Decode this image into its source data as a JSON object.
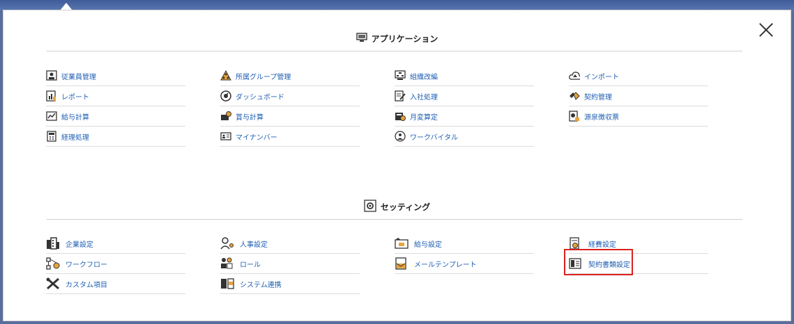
{
  "applications": {
    "title": "アプリケーション",
    "columns": [
      [
        "従業員管理",
        "レポート",
        "給与計算",
        "経理処理"
      ],
      [
        "所属グループ管理",
        "ダッシュボード",
        "賞与計算",
        "マイナンバー"
      ],
      [
        "組織改編",
        "入社処理",
        "月変算定",
        "ワークバイタル"
      ],
      [
        "インポート",
        "契約管理",
        "源泉徴収票"
      ]
    ]
  },
  "settings": {
    "title": "セッティング",
    "columns": [
      [
        "企業設定",
        "ワークフロー",
        "カスタム項目"
      ],
      [
        "人事設定",
        "ロール",
        "システム連携"
      ],
      [
        "給与設定",
        "メールテンプレート"
      ],
      [
        "経費設定",
        "契約書類設定"
      ]
    ]
  },
  "colors": {
    "link": "#1f5fb4",
    "highlight": "#d9211f"
  }
}
